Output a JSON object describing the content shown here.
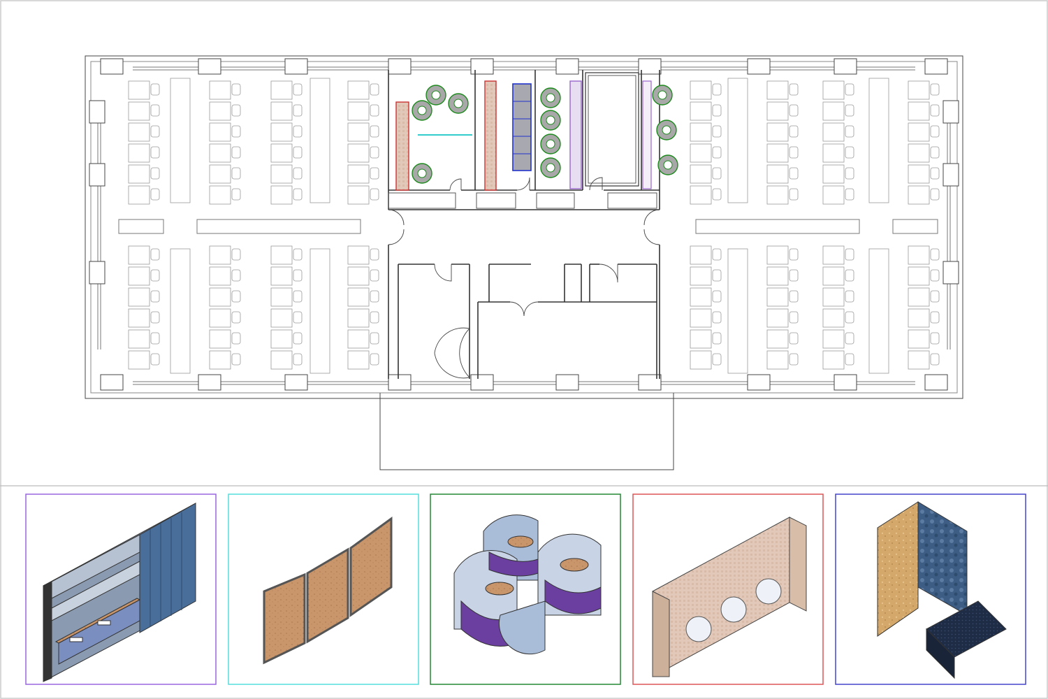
{
  "canvas": {
    "background": "#ffffff",
    "frame_color": "#cccccc"
  },
  "floor_plan": {
    "line_color": "#444444",
    "desk_line_color": "#9a9a9a",
    "accent_colors": {
      "pod_green": "#1e8a1e",
      "pod_fill": "#a8a8a8",
      "booth_red": "#cc3333",
      "screen_cyan": "#33cccc",
      "phone_blue": "#2233cc",
      "partition_purple": "#9966cc"
    }
  },
  "product_panels": [
    {
      "name": "acoustic-wall-bench",
      "border": "#9966dd"
    },
    {
      "name": "folding-screen",
      "border": "#55dddd"
    },
    {
      "name": "meeting-pods",
      "border": "#228833"
    },
    {
      "name": "shelving-wall",
      "border": "#dd5555"
    },
    {
      "name": "lounge-booth",
      "border": "#4444cc"
    }
  ]
}
